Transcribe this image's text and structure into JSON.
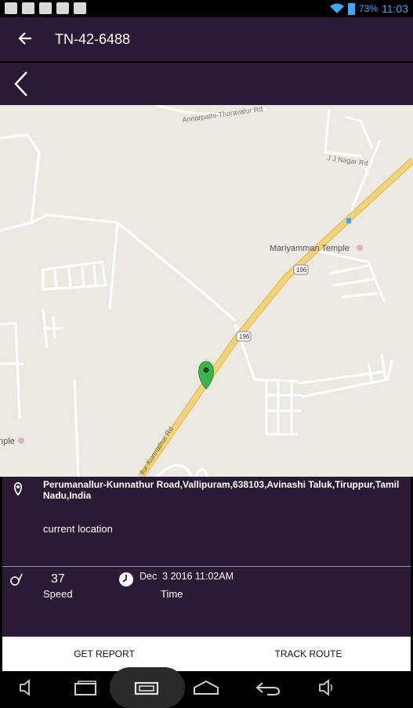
{
  "status_bar": {
    "battery": "73%",
    "time": "11:03",
    "left_icons": [
      "wrench-icon",
      "image-icon",
      "play-icon",
      "play-icon",
      "play-icon"
    ]
  },
  "toolbar": {
    "title": "TN-42-6488"
  },
  "map": {
    "labels": {
      "road_top": "Annarpathi-Thoravalur Rd",
      "road_jj": "J J Nagar Rd",
      "poi_temple": "Mariyamman Temple",
      "shield_1": "196",
      "shield_2": "196",
      "road_main": "llur-Kunnathur Rd",
      "poi_left": "nple"
    }
  },
  "info": {
    "address": "Perumanallur-Kunnathur Road,Vallipuram,638103,Avinashi Taluk,Tiruppur,Tamil Nadu,India",
    "caption": "current location",
    "speed_value": "37",
    "speed_label": "Speed",
    "time_value": "Dec  3 2016 11:02AM",
    "time_label": "Time"
  },
  "actions": {
    "get_report": "GET REPORT",
    "track_route": "TRACK ROUTE"
  },
  "colors": {
    "primary": "#2b1a33",
    "status_blue": "#3da9f4",
    "pin_green": "#3cb44b",
    "road_yellow": "#f3d27c"
  }
}
